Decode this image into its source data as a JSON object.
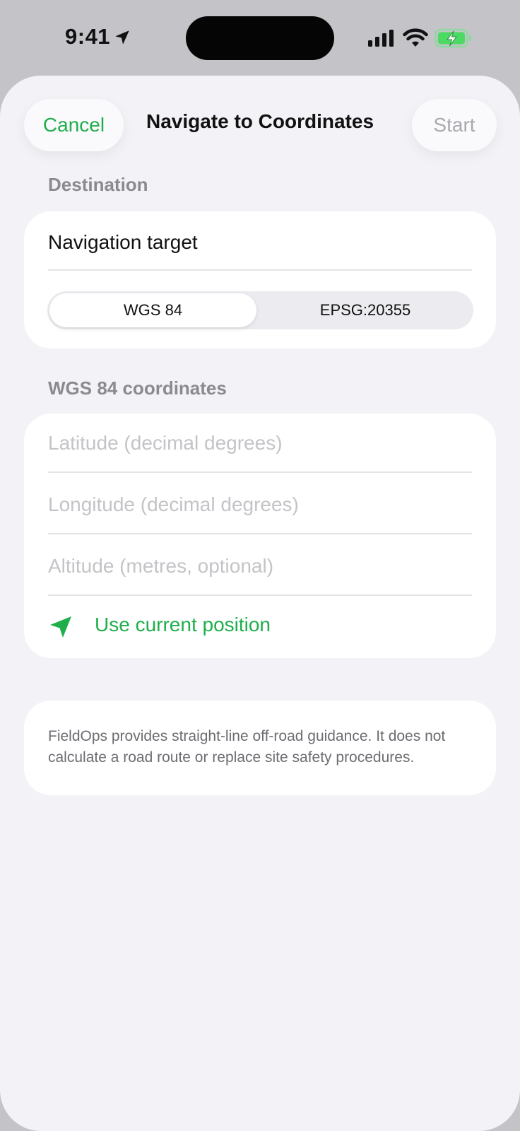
{
  "status_bar": {
    "time": "9:41",
    "icons": [
      "location-arrow-icon",
      "cellular-signal-icon",
      "wifi-icon",
      "battery-charging-icon"
    ]
  },
  "nav": {
    "cancel_label": "Cancel",
    "title": "Navigate to Coordinates",
    "start_label": "Start"
  },
  "destination": {
    "header": "Destination",
    "target_label": "Navigation target",
    "segments": [
      {
        "label": "WGS 84",
        "selected": true
      },
      {
        "label": "EPSG:20355",
        "selected": false
      }
    ]
  },
  "coordinates": {
    "header": "WGS 84 coordinates",
    "latitude_placeholder": "Latitude (decimal degrees)",
    "longitude_placeholder": "Longitude (decimal degrees)",
    "altitude_placeholder": "Altitude (metres, optional)",
    "use_current_label": "Use current position"
  },
  "note": {
    "text": "FieldOps provides straight-line off-road guidance. It does not calculate a road route or replace site safety procedures."
  },
  "colors": {
    "accent": "#1fae4b",
    "background": "#f2f2f7",
    "disabled": "#a8a8ae",
    "battery": "#4cd964"
  }
}
